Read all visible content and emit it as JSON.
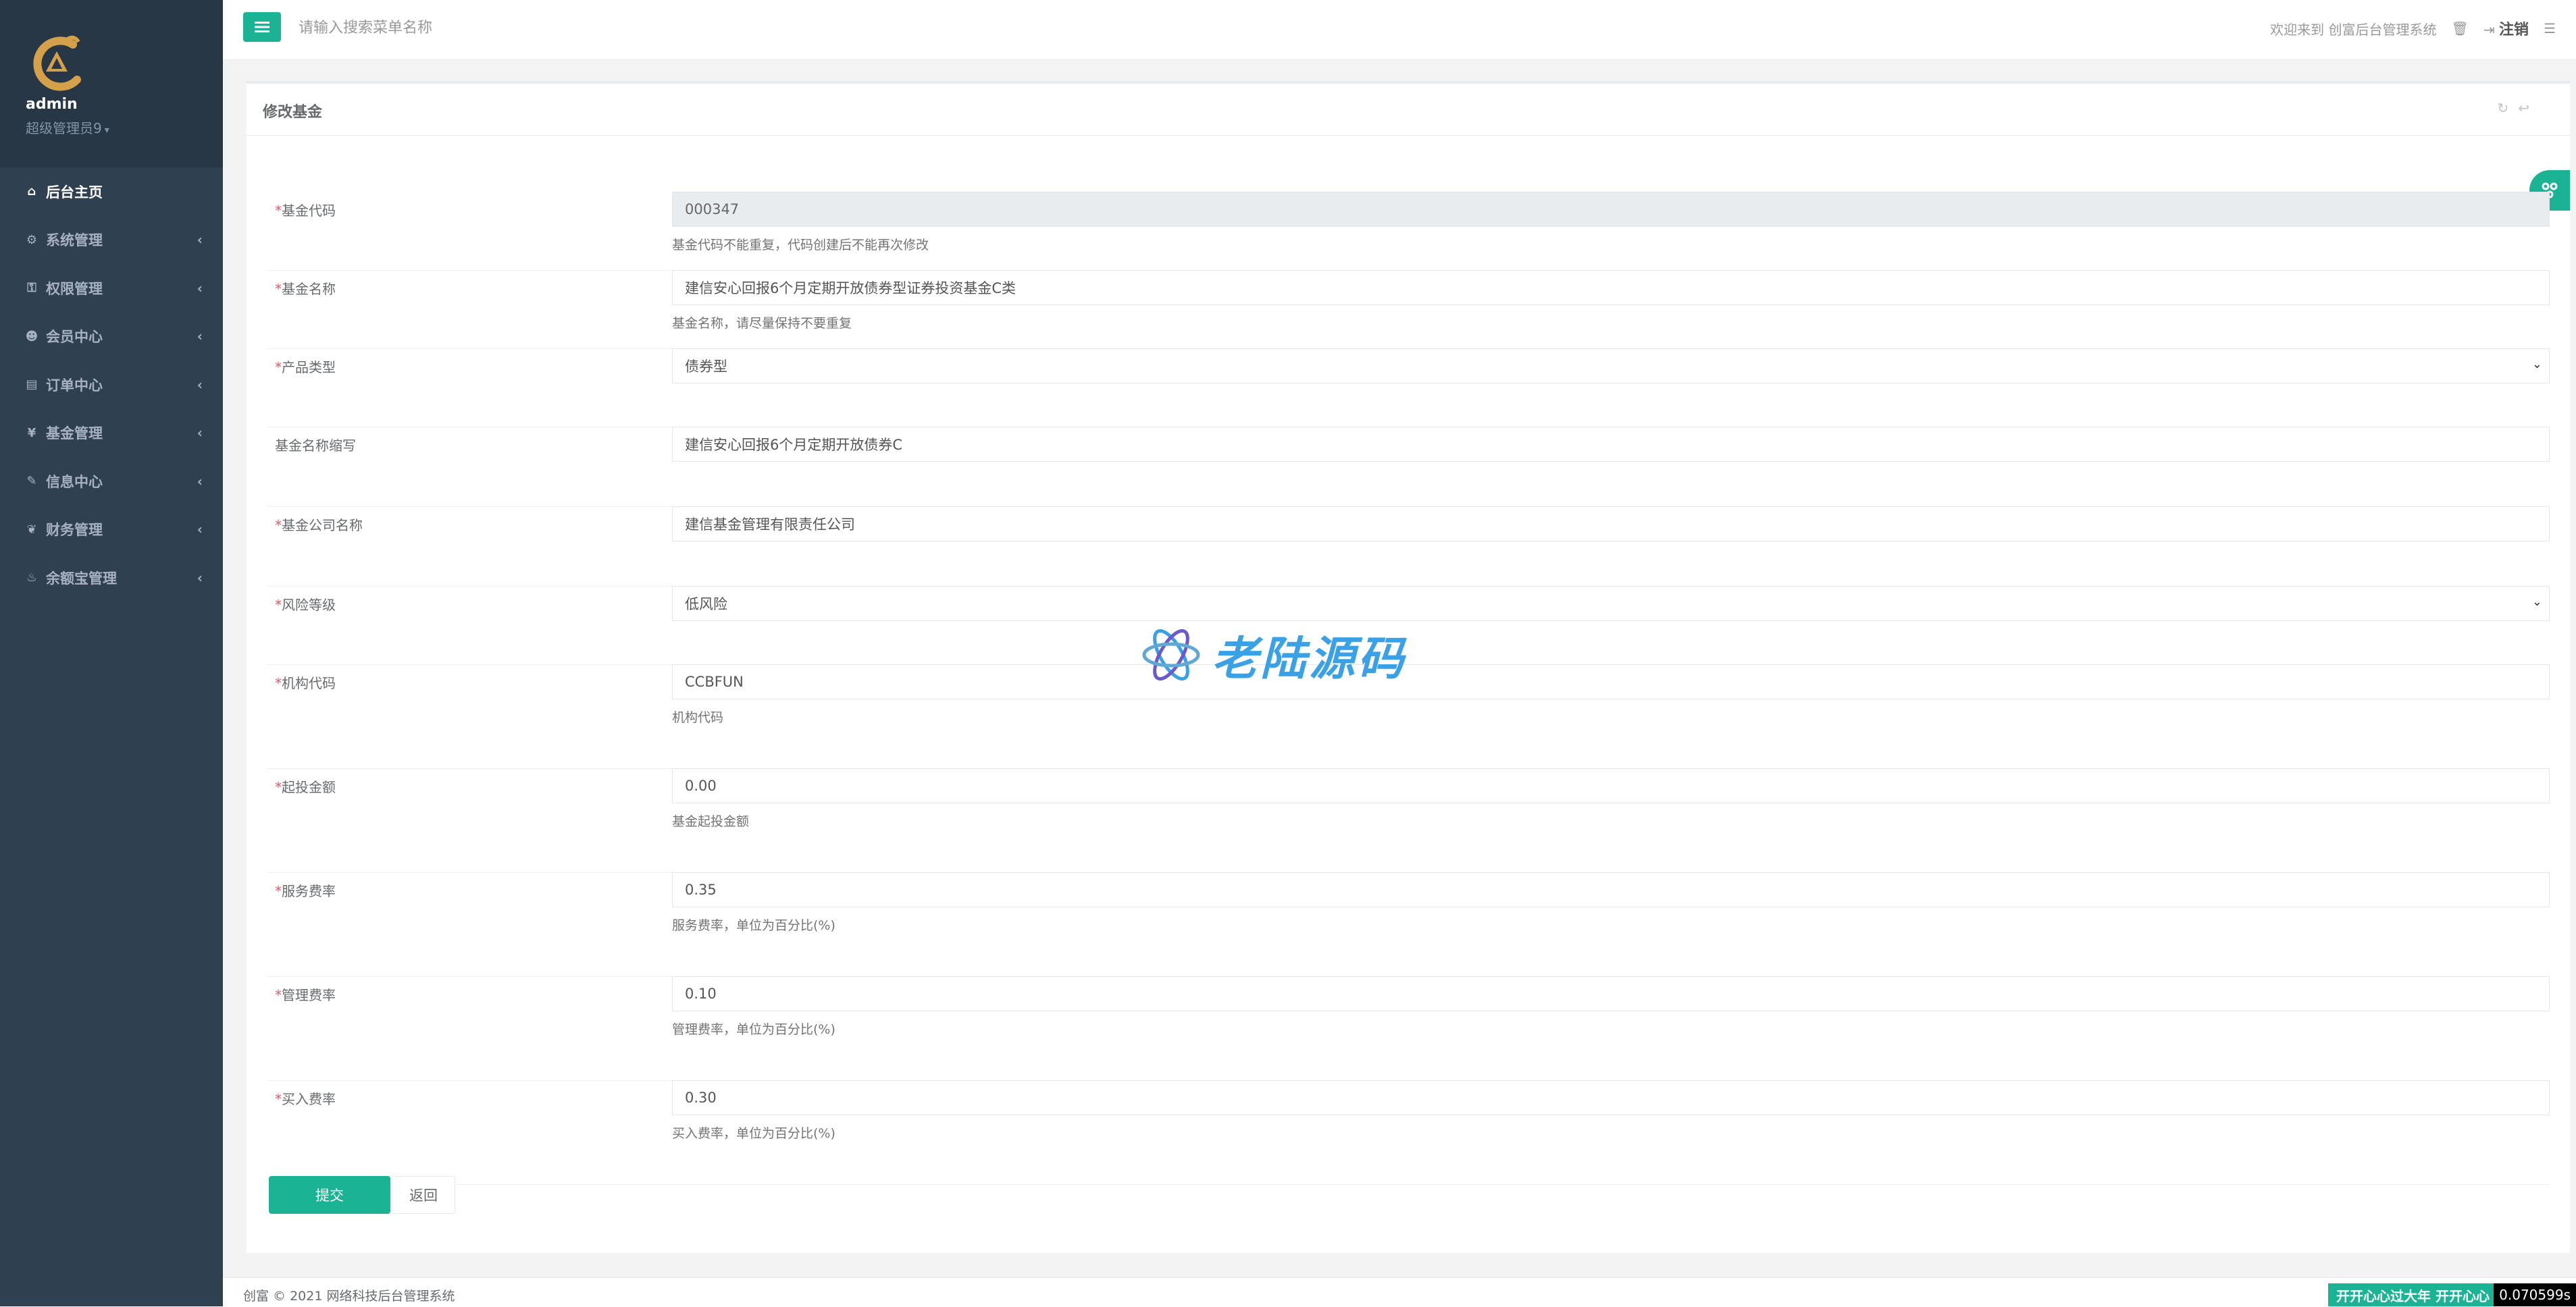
{
  "sidebar": {
    "user_name": "admin",
    "user_role": "超级管理员9",
    "items": [
      {
        "label": "后台主页",
        "icon": "home-icon",
        "glyph": "⌂",
        "has_arrow": false
      },
      {
        "label": "系统管理",
        "icon": "gears-icon",
        "glyph": "⚙",
        "has_arrow": true
      },
      {
        "label": "权限管理",
        "icon": "key-icon",
        "glyph": "⚿",
        "has_arrow": true
      },
      {
        "label": "会员中心",
        "icon": "user-icon",
        "glyph": "☻",
        "has_arrow": true
      },
      {
        "label": "订单中心",
        "icon": "list-icon",
        "glyph": "▤",
        "has_arrow": true
      },
      {
        "label": "基金管理",
        "icon": "yen-icon",
        "glyph": "¥",
        "has_arrow": true
      },
      {
        "label": "信息中心",
        "icon": "wrench-icon",
        "glyph": "✎",
        "has_arrow": true
      },
      {
        "label": "财务管理",
        "icon": "leaf-icon",
        "glyph": "❦",
        "has_arrow": true
      },
      {
        "label": "余额宝管理",
        "icon": "fire-icon",
        "glyph": "♨",
        "has_arrow": true
      }
    ],
    "arrow": "‹"
  },
  "topbar": {
    "search_placeholder": "请输入搜索菜单名称",
    "welcome": "欢迎来到 创富后台管理系统",
    "logout": "注销"
  },
  "panel": {
    "title": "修改基金"
  },
  "form": {
    "fields": [
      {
        "label": "基金代码",
        "required": true,
        "value": "000347",
        "help": "基金代码不能重复，代码创建后不能再次修改",
        "disabled": true
      },
      {
        "label": "基金名称",
        "required": true,
        "value": "建信安心回报6个月定期开放债券型证券投资基金C类",
        "help": "基金名称，请尽量保持不要重复"
      },
      {
        "label": "产品类型",
        "required": true,
        "value": "债券型",
        "select": true
      },
      {
        "label": "基金名称缩写",
        "required": false,
        "value": "建信安心回报6个月定期开放债券C"
      },
      {
        "label": "基金公司名称",
        "required": true,
        "value": "建信基金管理有限责任公司"
      },
      {
        "label": "风险等级",
        "required": true,
        "value": "低风险",
        "select": true
      },
      {
        "label": "机构代码",
        "required": true,
        "value": "CCBFUN",
        "help": "机构代码"
      },
      {
        "label": "起投金额",
        "required": true,
        "value": "0.00",
        "help": "基金起投金额"
      },
      {
        "label": "服务费率",
        "required": true,
        "value": "0.35",
        "help": "服务费率，单位为百分比(%)"
      },
      {
        "label": "管理费率",
        "required": true,
        "value": "0.10",
        "help": "管理费率，单位为百分比(%)"
      },
      {
        "label": "买入费率",
        "required": true,
        "value": "0.30",
        "help": "买入费率，单位为百分比(%)"
      }
    ],
    "submit_label": "提交",
    "back_label": "返回"
  },
  "watermark": "老陆源码",
  "footer": {
    "copyright": "创富 © 2021 网络科技后台管理系统",
    "badge": "开开心心过大年 开开心心",
    "timer": "0.070599s"
  },
  "colors": {
    "sidebar": "#2f4050",
    "accent": "#1ab394",
    "required": "#ed5565"
  }
}
